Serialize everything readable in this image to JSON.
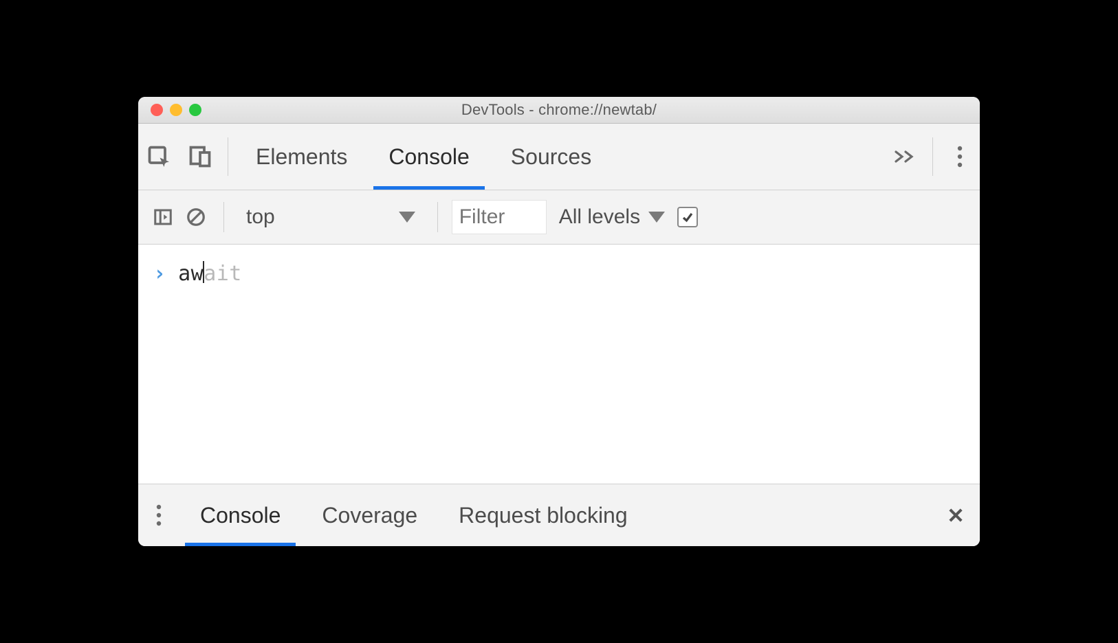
{
  "window": {
    "title": "DevTools - chrome://newtab/"
  },
  "main_tabs": [
    "Elements",
    "Console",
    "Sources"
  ],
  "main_tab_active_index": 1,
  "console_toolbar": {
    "context": "top",
    "filter_placeholder": "Filter",
    "levels_label": "All levels",
    "group_similar_checked": true
  },
  "input": {
    "typed": "aw",
    "suggestion_rest": "ait"
  },
  "drawer_tabs": [
    "Console",
    "Coverage",
    "Request blocking"
  ],
  "drawer_tab_active_index": 0
}
